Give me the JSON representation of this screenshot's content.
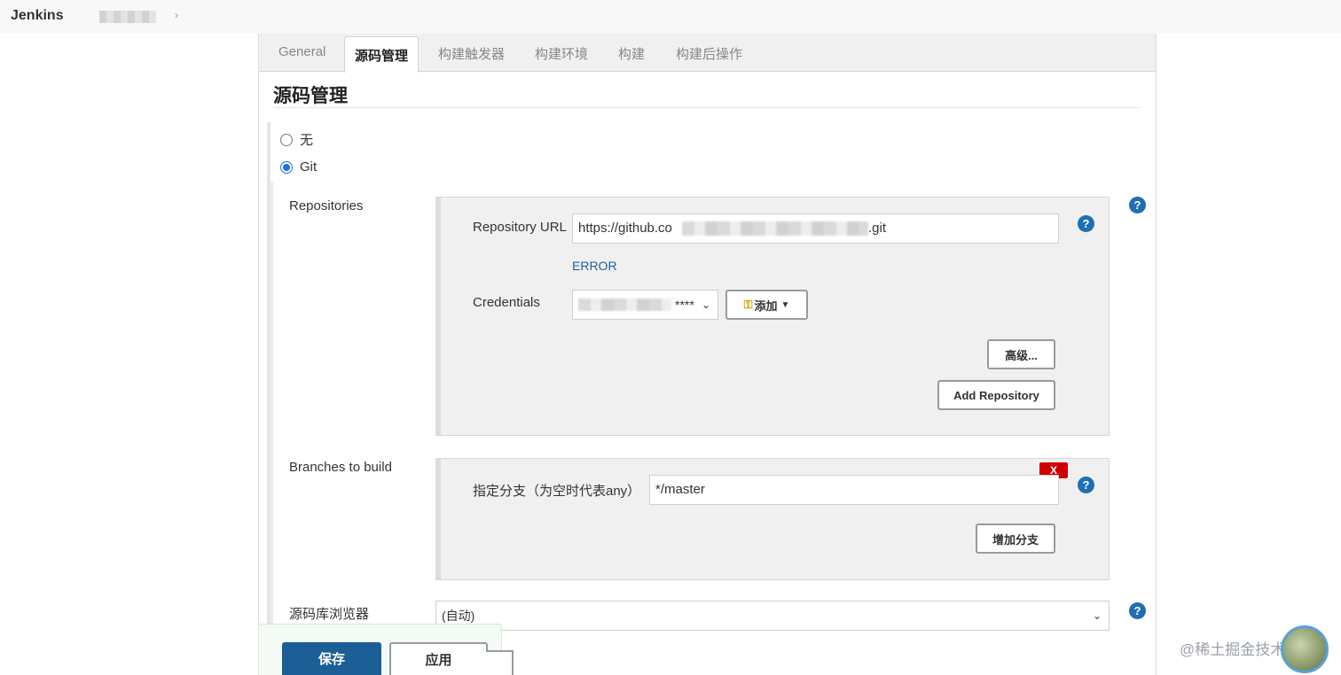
{
  "header": {
    "brand": "Jenkins"
  },
  "tabs": [
    "General",
    "源码管理",
    "构建触发器",
    "构建环境",
    "构建",
    "构建后操作"
  ],
  "active_tab": "源码管理",
  "section": {
    "title": "源码管理"
  },
  "scm_options": {
    "none_label": "无",
    "git_label": "Git",
    "selected": "Git"
  },
  "repositories": {
    "label": "Repositories",
    "repo_url_label": "Repository URL",
    "repo_url_value_start": "https://github.co",
    "repo_url_value_end": ".git",
    "error_text": "ERROR",
    "credentials_label": "Credentials",
    "credentials_value_suffix": "****",
    "add_credential_label": "添加",
    "advanced_label": "高级...",
    "add_repository_label": "Add Repository"
  },
  "branches": {
    "label": "Branches to build",
    "specifier_label": "指定分支（为空时代表any）",
    "specifier_value": "*/master",
    "delete_label": "X",
    "add_branch_label": "增加分支"
  },
  "repo_browser": {
    "label": "源码库浏览器",
    "selected": "(自动)"
  },
  "footer": {
    "save_label": "保存",
    "apply_label": "应用"
  },
  "watermark": "@稀土掘金技术社区",
  "colors": {
    "primary": "#1c5e96",
    "help": "#1f6fb2",
    "danger": "#cc0000",
    "error_text": "#1f5f96"
  }
}
